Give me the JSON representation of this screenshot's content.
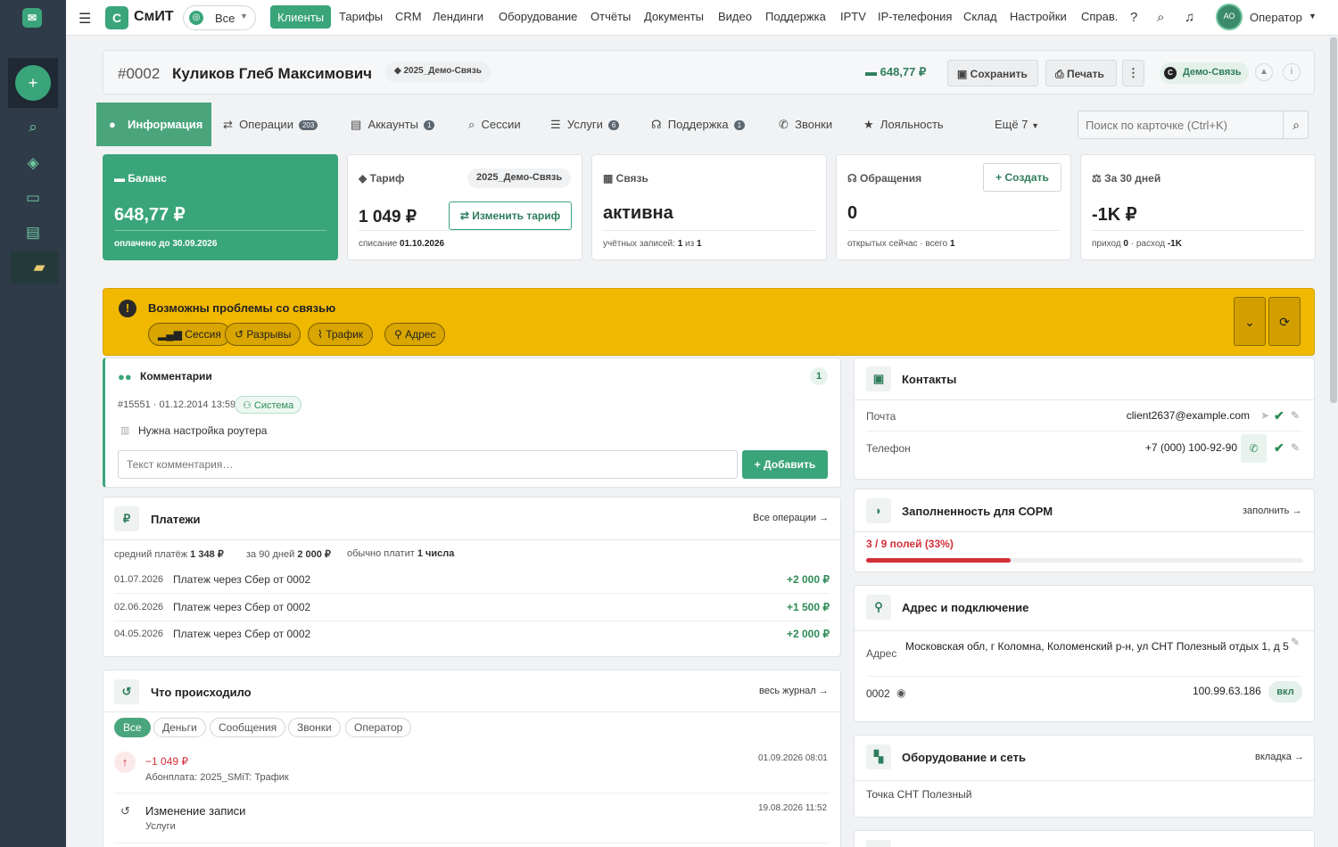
{
  "brand": {
    "mark": "С",
    "name": "СмИТ",
    "scope": "Все"
  },
  "nav": [
    "Клиенты",
    "Тарифы",
    "CRM",
    "Лендинги",
    "Оборудование",
    "Отчёты",
    "Документы",
    "Видео",
    "Поддержка",
    "IPTV",
    "IP-телефония",
    "Склад",
    "Настройки",
    "Справ."
  ],
  "user": {
    "initials": "АО",
    "role": "Оператор"
  },
  "header": {
    "id": "#0002",
    "name": "Куликов Глеб Максимович",
    "tag": "2025_Демо-Связь",
    "balance": "648,77 ₽",
    "save": "Сохранить",
    "print": "Печать",
    "org": "Демо-Связь",
    "org_mark": "С"
  },
  "tabs": [
    {
      "label": "Информация"
    },
    {
      "label": "Операции",
      "badge": "203"
    },
    {
      "label": "Аккаунты",
      "badge": "1"
    },
    {
      "label": "Сессии"
    },
    {
      "label": "Услуги",
      "badge": "6"
    },
    {
      "label": "Поддержка",
      "badge": "1"
    },
    {
      "label": "Звонки"
    },
    {
      "label": "Лояльность"
    },
    {
      "label": "Ещё 7"
    }
  ],
  "search": {
    "placeholder": "Поиск по карточке (Ctrl+K)"
  },
  "stats": {
    "balance": {
      "label": "Баланс",
      "value": "648,77 ₽",
      "sub_prefix": "оплачено до",
      "sub_value": "30.09.2026"
    },
    "tariff": {
      "label": "Тариф",
      "tag": "2025_Демо-Связь",
      "value": "1 049 ₽",
      "action": "Изменить тариф",
      "sub_prefix": "списание",
      "sub_value": "01.10.2026"
    },
    "link": {
      "label": "Связь",
      "value": "активна",
      "sub": "учётных записей:",
      "sub_a": "1",
      "sub_mid": "из",
      "sub_b": "1"
    },
    "tickets": {
      "label": "Обращения",
      "action": "Создать",
      "value": "0",
      "sub": "открытых сейчас · всего",
      "sub_value": "1"
    },
    "month": {
      "label": "За 30 дней",
      "value": "-1K ₽",
      "sub_a": "приход",
      "sub_a_val": "0",
      "sub_b": "· расход",
      "sub_b_val": "-1K"
    }
  },
  "alert": {
    "title": "Возможны проблемы со связью",
    "chips": [
      "Сессия",
      "Разрывы",
      "Трафик",
      "Адрес"
    ]
  },
  "comments": {
    "title": "Комментарии",
    "count": "1",
    "meta": "#15551 · 01.12.2014 13:59",
    "author": "Система",
    "text": "Нужна настройка роутера",
    "placeholder": "Текст комментария…",
    "add": "Добавить"
  },
  "payments": {
    "title": "Платежи",
    "link": "Все операции →",
    "summary": [
      {
        "label": "средний платёж",
        "value": "1 348 ₽"
      },
      {
        "label": "за 90 дней",
        "value": "2 000 ₽"
      },
      {
        "label": "обычно платит",
        "value": "1 числа"
      }
    ],
    "rows": [
      {
        "date": "01.07.2026",
        "desc": "Платеж через Сбер от 0002",
        "amount": "+2 000 ₽"
      },
      {
        "date": "02.06.2026",
        "desc": "Платеж через Сбер от 0002",
        "amount": "+1 500 ₽"
      },
      {
        "date": "04.05.2026",
        "desc": "Платеж через Сбер от 0002",
        "amount": "+2 000 ₽"
      }
    ]
  },
  "history": {
    "title": "Что происходило",
    "link": "весь журнал →",
    "filters": [
      "Все",
      "Деньги",
      "Сообщения",
      "Звонки",
      "Оператор"
    ],
    "items": [
      {
        "title": "−1 049 ₽",
        "sub": "Абонплата: 2025_SMiT: Трафик",
        "time": "01.09.2026 08:01"
      },
      {
        "title": "Изменение записи",
        "sub": "Услуги",
        "time": "19.08.2026 11:52"
      }
    ]
  },
  "contacts": {
    "title": "Контакты",
    "email_label": "Почта",
    "email": "client2637@example.com",
    "phone_label": "Телефон",
    "phone": "+7 (000) 100-92-90"
  },
  "sorm": {
    "title": "Заполненность для СОРМ",
    "link": "заполнить →",
    "value": "3 / 9 полей (33%)",
    "progress": 0.33
  },
  "address": {
    "title": "Адрес и подключение",
    "label": "Адрес",
    "value": "Московская обл, г Коломна, Коломенский р-н, ул СНТ Полезный отдых 1, д 5",
    "account": "0002",
    "ip": "100.99.63.186",
    "state": "вкл"
  },
  "equipment": {
    "title": "Оборудование и сеть",
    "link": "вкладка →",
    "point": "Точка СНТ Полезный"
  },
  "colors": {
    "accent": "#3aa57a",
    "sidebar": "#2f3b48",
    "alert": "#f0b800",
    "danger": "#d32f3a"
  }
}
